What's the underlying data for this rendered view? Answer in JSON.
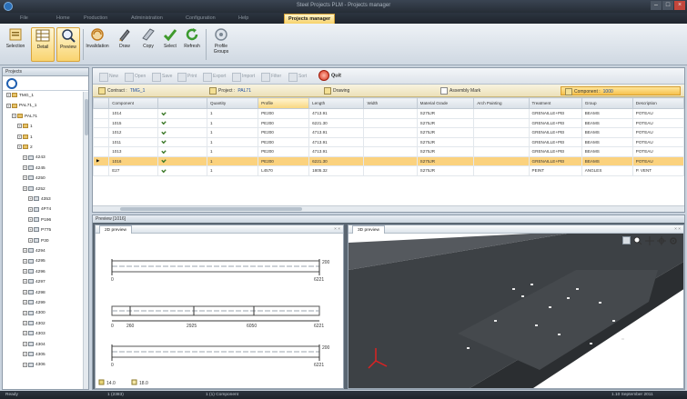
{
  "window": {
    "title": "Steel Projects PLM - Projects manager",
    "min_label": "–",
    "max_label": "□",
    "close_label": "×"
  },
  "ribbon_tabs": [
    {
      "label": "File"
    },
    {
      "label": "Home"
    },
    {
      "label": "Production"
    },
    {
      "label": "Administration"
    },
    {
      "label": "Configuration"
    },
    {
      "label": "Help"
    },
    {
      "label": "Projects manager"
    }
  ],
  "ribbon_buttons": [
    {
      "label": "Selection",
      "icon": "selection-icon"
    },
    {
      "label": "Detail",
      "icon": "detail-icon"
    },
    {
      "label": "Preview",
      "icon": "preview-icon"
    },
    {
      "label": "Invalidation",
      "icon": "invalidation-icon"
    },
    {
      "label": "Draw",
      "icon": "draw-icon"
    },
    {
      "label": "Copy",
      "icon": "copy-icon"
    },
    {
      "label": "Select",
      "icon": "select-icon"
    },
    {
      "label": "Refresh",
      "icon": "refresh-icon"
    },
    {
      "label": "Profile Groups",
      "icon": "profile-groups-icon"
    }
  ],
  "tree": {
    "header": "Projects",
    "nodes": [
      {
        "label": "TMG_1",
        "depth": 0
      },
      {
        "label": "PAL71_1",
        "depth": 0
      },
      {
        "label": "PAL71",
        "depth": 1
      },
      {
        "label": "1",
        "depth": 2
      },
      {
        "label": "1",
        "depth": 2
      },
      {
        "label": "2",
        "depth": 2
      },
      {
        "label": "4243",
        "depth": 3
      },
      {
        "label": "4245",
        "depth": 3
      },
      {
        "label": "4250",
        "depth": 3
      },
      {
        "label": "4252",
        "depth": 3
      },
      {
        "label": "4353",
        "depth": 4
      },
      {
        "label": "4P74",
        "depth": 4
      },
      {
        "label": "P196",
        "depth": 4
      },
      {
        "label": "P775",
        "depth": 4
      },
      {
        "label": "P30",
        "depth": 4
      },
      {
        "label": "4294",
        "depth": 3
      },
      {
        "label": "4295",
        "depth": 3
      },
      {
        "label": "4296",
        "depth": 3
      },
      {
        "label": "4297",
        "depth": 3
      },
      {
        "label": "4298",
        "depth": 3
      },
      {
        "label": "4299",
        "depth": 3
      },
      {
        "label": "4300",
        "depth": 3
      },
      {
        "label": "4302",
        "depth": 3
      },
      {
        "label": "4303",
        "depth": 3
      },
      {
        "label": "4304",
        "depth": 3
      },
      {
        "label": "4305",
        "depth": 3
      },
      {
        "label": "4306",
        "depth": 3
      }
    ]
  },
  "grid_toolbar": {
    "items": [
      "New",
      "Open",
      "Save",
      "Print",
      "Export",
      "Import",
      "Filter",
      "Sort"
    ],
    "quit_label": "Quit"
  },
  "filter_bar": {
    "contract_label": "Contract :",
    "contract_value": "TMG_1",
    "project_label": "Project :",
    "project_value": "PAL71",
    "drawing_label": "Drawing",
    "assembly_label": "Assembly Mark",
    "component_label": "Component :",
    "component_value": "1000"
  },
  "grid": {
    "columns": [
      "",
      "Component",
      "",
      "Quantity",
      "Profile",
      "Length",
      "Width",
      "Material Grade",
      "Arch Painting",
      "Treatment",
      "Group",
      "Description"
    ],
    "rows": [
      {
        "ptr": "",
        "component": "1014",
        "quantity": "1",
        "profile": "PE200",
        "length": "4713.91",
        "width": "",
        "grade": "S275JR",
        "painting": "",
        "treatment": "GRENAILLE+PEI",
        "group": "BEAMS",
        "description": "POTEAU"
      },
      {
        "ptr": "",
        "component": "1015",
        "quantity": "1",
        "profile": "PE200",
        "length": "6221.30",
        "width": "",
        "grade": "S275JR",
        "painting": "",
        "treatment": "GRENAILLE+PEI",
        "group": "BEAMS",
        "description": "POTEAU"
      },
      {
        "ptr": "",
        "component": "1012",
        "quantity": "1",
        "profile": "PE200",
        "length": "4713.91",
        "width": "",
        "grade": "S275JR",
        "painting": "",
        "treatment": "GRENAILLE+PEI",
        "group": "BEAMS",
        "description": "POTEAU"
      },
      {
        "ptr": "",
        "component": "1011",
        "quantity": "1",
        "profile": "PE200",
        "length": "4713.91",
        "width": "",
        "grade": "S275JR",
        "painting": "",
        "treatment": "GRENAILLE+PEI",
        "group": "BEAMS",
        "description": "POTEAU"
      },
      {
        "ptr": "",
        "component": "1013",
        "quantity": "1",
        "profile": "PE200",
        "length": "4713.91",
        "width": "",
        "grade": "S275JR",
        "painting": "",
        "treatment": "GRENAILLE+PEI",
        "group": "BEAMS",
        "description": "POTEAU"
      },
      {
        "ptr": "▶",
        "component": "1016",
        "quantity": "1",
        "profile": "PE200",
        "length": "6221.30",
        "width": "",
        "grade": "S275JR",
        "painting": "",
        "treatment": "GRENAILLE+PEI",
        "group": "BEAMS",
        "description": "POTEAU"
      },
      {
        "ptr": "",
        "component": "E27",
        "quantity": "1",
        "profile": "L4570",
        "length": "1805.32",
        "width": "",
        "grade": "S275JR",
        "painting": "",
        "treatment": "PEINT",
        "group": "ANGLES",
        "description": "P. VENT"
      }
    ]
  },
  "preview": {
    "header": "Preview [1016]",
    "tab2d": "2D preview",
    "tab3d": "3D preview",
    "views": [
      {
        "right_top": "200",
        "right_bottom": "6221",
        "left": "0"
      },
      {
        "right_top": "",
        "right_bottom": "6221",
        "left": "0",
        "dims": [
          "260",
          "2925",
          "6050"
        ]
      },
      {
        "right_top": "200",
        "right_bottom": "6221",
        "left": "0"
      }
    ],
    "legend": [
      {
        "label": "14.0"
      },
      {
        "label": "18.0"
      }
    ]
  },
  "statusbar": {
    "left": "Ready",
    "count": "1 (2383)",
    "component": "1 (1) Component",
    "right": "1.10 September 2011"
  },
  "colors": {
    "accent": "#f7c54a",
    "selection": "#fbd27e",
    "titlebar": "#262d36",
    "beam": "#4a4e52"
  }
}
